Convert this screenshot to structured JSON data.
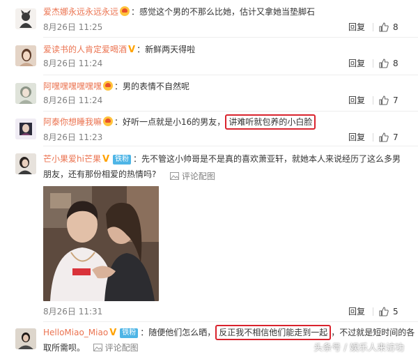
{
  "comments": [
    {
      "username": "爱杰娜永远永远永远",
      "colon": "：",
      "text": "感觉这个男的不那么比她，估计又拿她当垫脚石",
      "time": "8月26日 11:25",
      "reply": "回复",
      "likes": "8"
    },
    {
      "username": "爱读书的人肯定爱喝酒",
      "colon": "：",
      "text": "新鲜两天得啦",
      "time": "8月26日 11:24",
      "reply": "回复",
      "likes": "8"
    },
    {
      "username": "阿嘿嘿嘿嘿嘿嘿",
      "colon": "：",
      "text": "男的表情不自然呢",
      "time": "8月26日 11:24",
      "reply": "回复",
      "likes": "7"
    },
    {
      "username": "阿泰你想睡我嘛",
      "colon": "：",
      "text": "好听一点就是小16的男友，",
      "highlight": "讲难听就包养的小白脸",
      "time": "8月26日 11:23",
      "reply": "回复",
      "likes": "7"
    },
    {
      "username": "芒小果爱hi芒果",
      "fan_badge": "铁粉",
      "colon": "：",
      "text_line1": "先不管这小帅哥是不是真的喜欢萧亚轩，就她本人来说经历了这么多男",
      "text_line2": "朋友，还有那份相爱的热情吗?",
      "pic_link": "评论配图",
      "time": "8月26日 11:31",
      "reply": "回复",
      "likes": "5"
    },
    {
      "username": "HelloMiao_Miao",
      "fan_badge": "铁粉",
      "colon": "：",
      "text_before": "随便他们怎么晒，",
      "highlight": "反正我不相信他们能走到一起",
      "text_after": "，不过就是短时间的各",
      "text_line2": "取所需呗。",
      "pic_link": "评论配图"
    }
  ],
  "watermark": "头条号 / 娱乐人来访功",
  "colors": {
    "username": "#eb7350",
    "highlight_border": "#d9232d",
    "fan_badge": "#4eb5e6"
  }
}
